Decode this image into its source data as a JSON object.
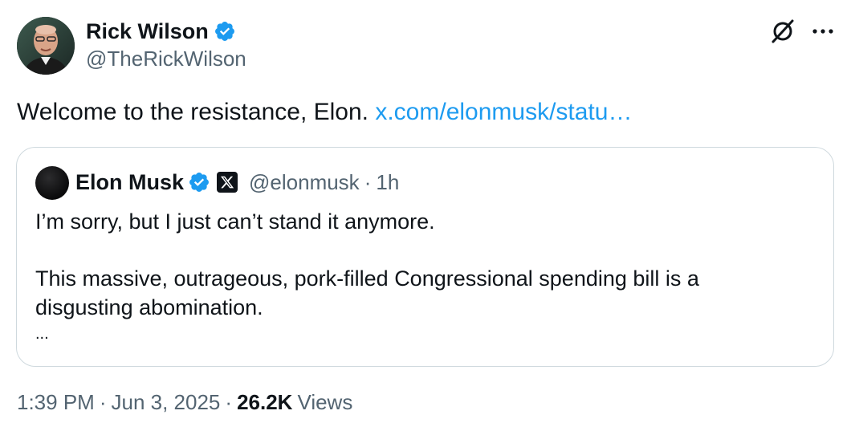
{
  "author": {
    "display_name": "Rick Wilson",
    "handle": "@TheRickWilson",
    "avatar_icon": "person-photo",
    "verified_icon": "verified-badge-icon",
    "verified_color": "#1d9bf0"
  },
  "actions": {
    "grok_icon": "grok-icon",
    "more_icon": "more-options-icon"
  },
  "tweet": {
    "text": "Welcome to the resistance, Elon.",
    "link_text": "x.com/elonmusk/statu…"
  },
  "quoted": {
    "display_name": "Elon Musk",
    "handle": "@elonmusk",
    "separator": "·",
    "time": "1h",
    "verified_icon": "verified-badge-icon",
    "affiliate_badge_icon": "x-logo-icon",
    "lines": [
      "I’m sorry, but I just can’t stand it anymore.",
      "This massive, outrageous, pork-filled Congressional spending bill is a",
      "disgusting abomination.",
      "..."
    ]
  },
  "meta": {
    "time": "1:39 PM",
    "separator": "·",
    "date": "Jun 3, 2025",
    "views_count": "26.2K",
    "views_label": "Views"
  },
  "colors": {
    "link": "#1d9bf0",
    "secondary_text": "#536471",
    "primary_text": "#0f1419",
    "border": "#cfd9de"
  }
}
